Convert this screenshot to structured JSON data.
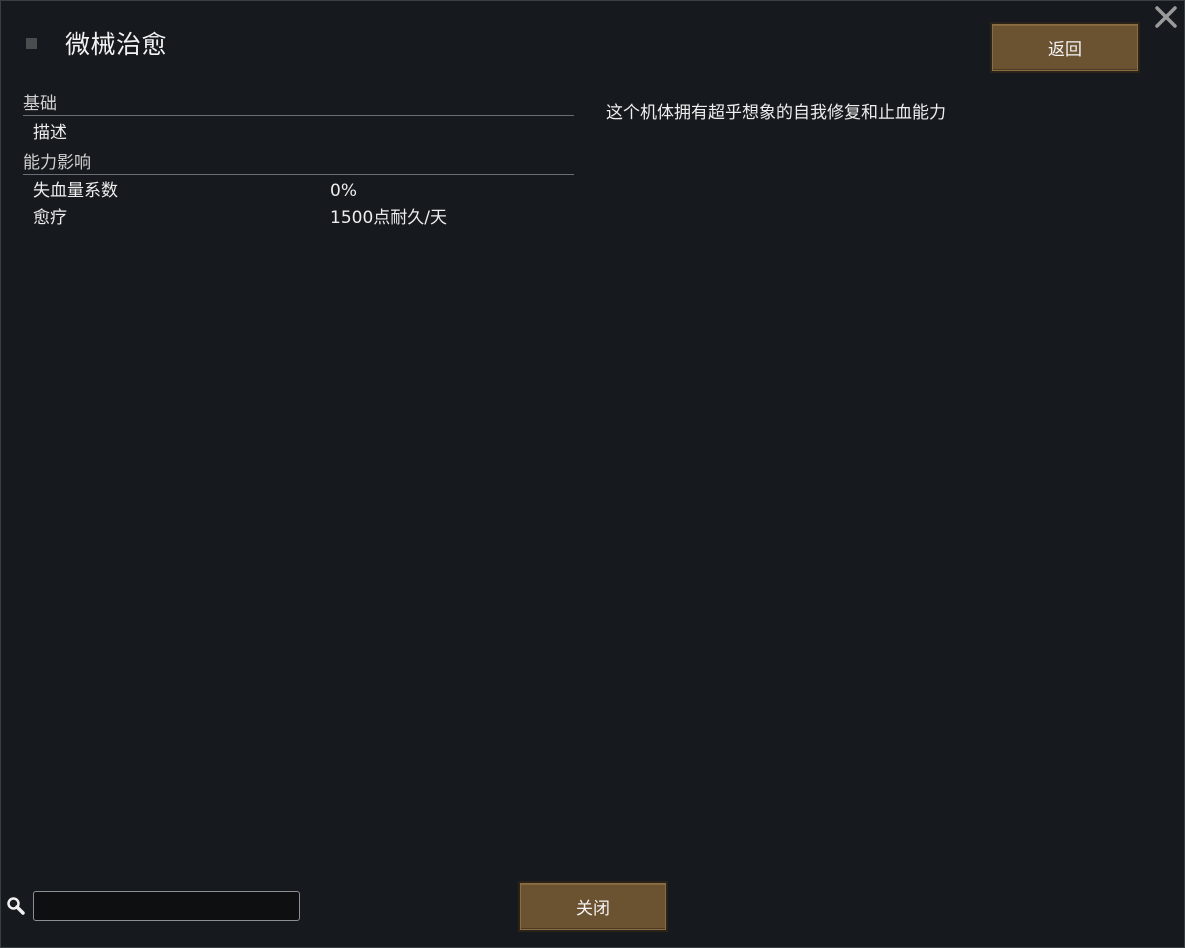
{
  "window": {
    "title": "微械治愈",
    "back_label": "返回",
    "close_label": "关闭"
  },
  "stats": {
    "sections": [
      {
        "header": "基础",
        "rows": [
          {
            "label": "描述",
            "value": ""
          }
        ]
      },
      {
        "header": "能力影响",
        "rows": [
          {
            "label": "失血量系数",
            "value": "0%"
          },
          {
            "label": "愈疗",
            "value": "1500点耐久/天"
          }
        ]
      }
    ]
  },
  "description": "这个机体拥有超乎想象的自我修复和止血能力",
  "search": {
    "value": "",
    "placeholder": ""
  },
  "icons": {
    "close": "close-icon",
    "search": "search-icon",
    "title": "square-icon"
  },
  "colors": {
    "background": "#161a1e",
    "button_wood": "#6b5332",
    "text": "#ededed"
  }
}
